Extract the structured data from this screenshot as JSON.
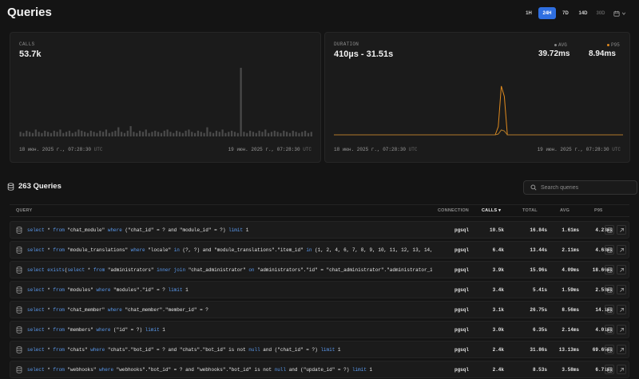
{
  "header": {
    "title": "Queries"
  },
  "ranges": [
    {
      "label": "1H",
      "state": "normal"
    },
    {
      "label": "24H",
      "state": "active"
    },
    {
      "label": "7D",
      "state": "normal"
    },
    {
      "label": "14D",
      "state": "normal"
    },
    {
      "label": "30D",
      "state": "muted"
    }
  ],
  "calls_card": {
    "label": "CALLS",
    "value": "53.7k",
    "start": "18 июн. 2025 г., 07:28:30",
    "end": "19 июн. 2025 г., 07:28:30",
    "tz": "UTC"
  },
  "duration_card": {
    "label": "DURATION",
    "value": "410µs - 31.51s",
    "avg_label": "AVG",
    "avg_value": "39.72ms",
    "p95_label": "P95",
    "p95_value": "8.94ms",
    "start": "18 июн. 2025 г., 07:28:30",
    "end": "19 июн. 2025 г., 07:28:30",
    "tz": "UTC",
    "colors": {
      "avg": "#8a8a8a",
      "p95": "#e08a1e"
    }
  },
  "queries": {
    "title": "263 Queries",
    "search_placeholder": "Search queries",
    "columns": {
      "query": "QUERY",
      "connection": "CONNECTION",
      "calls": "CALLS",
      "total": "TOTAL",
      "avg": "AVG",
      "p95": "P95"
    },
    "rows": [
      {
        "sql": [
          [
            "k",
            "select"
          ],
          [
            "t",
            " * "
          ],
          [
            "k",
            "from"
          ],
          [
            "t",
            " \"chat_module\" "
          ],
          [
            "k",
            "where"
          ],
          [
            "t",
            " (\"chat_id\" = ? and \"module_id\" = ?) "
          ],
          [
            "k",
            "limit"
          ],
          [
            "t",
            " 1"
          ]
        ],
        "connection": "pgsql",
        "calls": "10.5k",
        "total": "16.84s",
        "avg": "1.61ms",
        "p95": "4.23ms"
      },
      {
        "sql": [
          [
            "k",
            "select"
          ],
          [
            "t",
            " * "
          ],
          [
            "k",
            "from"
          ],
          [
            "t",
            " \"module_translations\" "
          ],
          [
            "k",
            "where"
          ],
          [
            "t",
            " \"locale\" "
          ],
          [
            "k",
            "in"
          ],
          [
            "t",
            " (?, ?) and \"module_translations\".\"item_id\" "
          ],
          [
            "k",
            "in"
          ],
          [
            "t",
            " (1, 2, 4, 6, 7, 8, 9, 10, 11, 12, 13, 14,"
          ]
        ],
        "connection": "pgsql",
        "calls": "6.4k",
        "total": "13.44s",
        "avg": "2.11ms",
        "p95": "4.68ms"
      },
      {
        "sql": [
          [
            "k",
            "select"
          ],
          [
            "t",
            " "
          ],
          [
            "k",
            "exists"
          ],
          [
            "t",
            "("
          ],
          [
            "k",
            "select"
          ],
          [
            "t",
            " * "
          ],
          [
            "k",
            "from"
          ],
          [
            "t",
            " \"administrators\" "
          ],
          [
            "k",
            "inner join"
          ],
          [
            "t",
            " \"chat_administrator\" "
          ],
          [
            "k",
            "on"
          ],
          [
            "t",
            " \"administrators\".\"id\" = \"chat_administrator\".\"administrator_i"
          ]
        ],
        "connection": "pgsql",
        "calls": "3.9k",
        "total": "15.96s",
        "avg": "4.09ms",
        "p95": "18.66ms"
      },
      {
        "sql": [
          [
            "k",
            "select"
          ],
          [
            "t",
            " * "
          ],
          [
            "k",
            "from"
          ],
          [
            "t",
            " \"modules\" "
          ],
          [
            "k",
            "where"
          ],
          [
            "t",
            " \"modules\".\"id\" = ? "
          ],
          [
            "k",
            "limit"
          ],
          [
            "t",
            " 1"
          ]
        ],
        "connection": "pgsql",
        "calls": "3.4k",
        "total": "5.41s",
        "avg": "1.59ms",
        "p95": "2.58ms"
      },
      {
        "sql": [
          [
            "k",
            "select"
          ],
          [
            "t",
            " * "
          ],
          [
            "k",
            "from"
          ],
          [
            "t",
            " \"chat_member\" "
          ],
          [
            "k",
            "where"
          ],
          [
            "t",
            " \"chat_member\".\"member_id\" = ?"
          ]
        ],
        "connection": "pgsql",
        "calls": "3.1k",
        "total": "26.75s",
        "avg": "8.56ms",
        "p95": "14.1ms"
      },
      {
        "sql": [
          [
            "k",
            "select"
          ],
          [
            "t",
            " * "
          ],
          [
            "k",
            "from"
          ],
          [
            "t",
            " \"members\" "
          ],
          [
            "k",
            "where"
          ],
          [
            "t",
            " (\"id\" = ?) "
          ],
          [
            "k",
            "limit"
          ],
          [
            "t",
            " 1"
          ]
        ],
        "connection": "pgsql",
        "calls": "3.0k",
        "total": "6.35s",
        "avg": "2.14ms",
        "p95": "4.01ms"
      },
      {
        "sql": [
          [
            "k",
            "select"
          ],
          [
            "t",
            " * "
          ],
          [
            "k",
            "from"
          ],
          [
            "t",
            " \"chats\" "
          ],
          [
            "k",
            "where"
          ],
          [
            "t",
            " \"chats\".\"bot_id\" = ? and \"chats\".\"bot_id\" is not "
          ],
          [
            "k",
            "null"
          ],
          [
            "t",
            " and (\"chat_id\" = ?) "
          ],
          [
            "k",
            "limit"
          ],
          [
            "t",
            " 1"
          ]
        ],
        "connection": "pgsql",
        "calls": "2.4k",
        "total": "31.86s",
        "avg": "13.13ms",
        "p95": "69.65ms"
      },
      {
        "sql": [
          [
            "k",
            "select"
          ],
          [
            "t",
            " * "
          ],
          [
            "k",
            "from"
          ],
          [
            "t",
            " \"webhooks\" "
          ],
          [
            "k",
            "where"
          ],
          [
            "t",
            " \"webhooks\".\"bot_id\" = ? and \"webhooks\".\"bot_id\" is not "
          ],
          [
            "k",
            "null"
          ],
          [
            "t",
            " and (\"update_id\" = ?) "
          ],
          [
            "k",
            "limit"
          ],
          [
            "t",
            " 1"
          ]
        ],
        "connection": "pgsql",
        "calls": "2.4k",
        "total": "8.53s",
        "avg": "3.58ms",
        "p95": "6.71ms"
      }
    ]
  },
  "chart_data": [
    {
      "type": "bar",
      "title": "CALLS",
      "xlabel": "",
      "ylabel": "",
      "values": [
        4,
        3,
        5,
        4,
        3,
        6,
        4,
        3,
        5,
        4,
        3,
        5,
        4,
        6,
        3,
        4,
        5,
        3,
        4,
        6,
        5,
        4,
        3,
        5,
        4,
        3,
        5,
        4,
        6,
        3,
        4,
        5,
        8,
        4,
        3,
        5,
        9,
        4,
        3,
        5,
        4,
        6,
        3,
        4,
        5,
        4,
        3,
        5,
        6,
        4,
        3,
        5,
        4,
        3,
        5,
        6,
        4,
        3,
        5,
        4,
        3,
        8,
        4,
        3,
        5,
        4,
        6,
        3,
        4,
        5,
        4,
        3,
        60,
        4,
        3,
        5,
        4,
        3,
        5,
        4,
        6,
        3,
        4,
        5,
        4,
        3,
        5,
        4,
        3,
        5,
        4,
        3,
        4,
        5,
        3,
        4
      ]
    },
    {
      "type": "line",
      "title": "DURATION",
      "series": [
        {
          "name": "AVG",
          "values": [
            0,
            0,
            0,
            0,
            0,
            0,
            0,
            0,
            0,
            0,
            0,
            0,
            0,
            0,
            0,
            0,
            0,
            0,
            0,
            0,
            0,
            0,
            0,
            0,
            0,
            0,
            0,
            0,
            0,
            0,
            0,
            0,
            0,
            0,
            0,
            0,
            0,
            0,
            0,
            0,
            0,
            0,
            0,
            0,
            0,
            0,
            0,
            0,
            0,
            0,
            0,
            0,
            0,
            0,
            0,
            0,
            0,
            0,
            0,
            0,
            0,
            0,
            0,
            0,
            0,
            0,
            0,
            0,
            0,
            0,
            0,
            0,
            0,
            0,
            0,
            0,
            0,
            0,
            0,
            0,
            0,
            0,
            0,
            0,
            0,
            0,
            0,
            0,
            0,
            0,
            0,
            0,
            0,
            0,
            0,
            0
          ]
        },
        {
          "name": "P95",
          "values": [
            0,
            0,
            0,
            0,
            0,
            0,
            0,
            0,
            0,
            0,
            0,
            0,
            0,
            0,
            0,
            0,
            0,
            0,
            0,
            0,
            0,
            0,
            0,
            0,
            0,
            0,
            0,
            0,
            0,
            0,
            0,
            0,
            0,
            0,
            0,
            0,
            0,
            0,
            0,
            0,
            0,
            0,
            0,
            0,
            0,
            0,
            0,
            0,
            0,
            0,
            0,
            0,
            0,
            0,
            0,
            0,
            0,
            0,
            0,
            0,
            0,
            0,
            0,
            0,
            0,
            0,
            0,
            0,
            0,
            0,
            0,
            0,
            0,
            0,
            0,
            0,
            0,
            0,
            0,
            0,
            0,
            0,
            0,
            0,
            0,
            0,
            0,
            0,
            0,
            0,
            0,
            0,
            0,
            0,
            0,
            0
          ]
        }
      ]
    }
  ]
}
